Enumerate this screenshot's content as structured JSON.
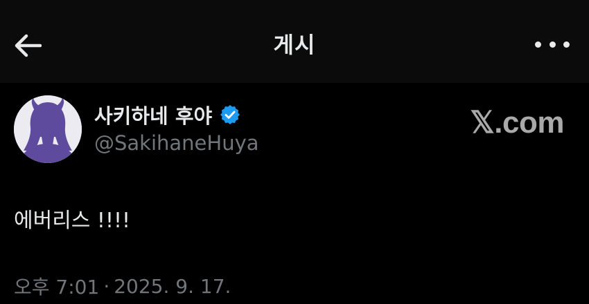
{
  "header": {
    "title": "게시",
    "back_icon": "arrow-left-icon",
    "more_icon": "more-horizontal-icon"
  },
  "post": {
    "author": {
      "display_name": "사키하네 후야",
      "handle": "@SakihaneHuya",
      "verified": true,
      "verified_color": "#1d9bf0",
      "avatar_color": "#5f4b9e"
    },
    "text": "에버리스 !!!!",
    "time": "오후 7:01",
    "separator": "·",
    "date": "2025. 9. 17."
  },
  "watermark": {
    "text": "𝕏.com"
  },
  "colors": {
    "background": "#000000",
    "header_background": "#0b0b0b",
    "primary_text": "#e7e9ea",
    "secondary_text": "#71767b",
    "watermark_text": "#a9a9a9"
  }
}
